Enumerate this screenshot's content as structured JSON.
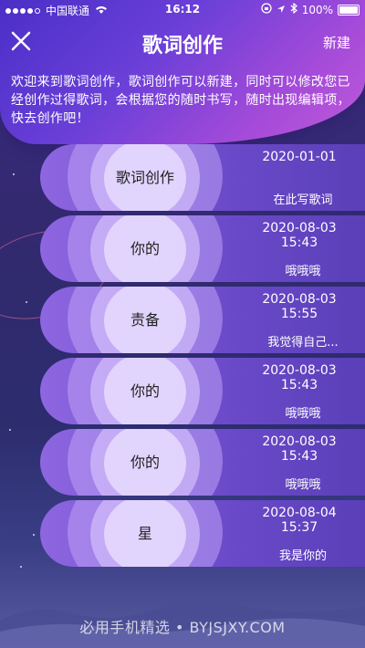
{
  "status_bar": {
    "carrier": "中国联通",
    "time": "16:12",
    "battery": "100%"
  },
  "nav": {
    "title": "歌词创作",
    "new_label": "新建"
  },
  "intro": "欢迎来到歌词创作，歌词创作可以新建，同时可以修改您已经创作过得歌词，会根据您的随时书写，随时出现编辑项，快去创作吧！",
  "cards": [
    {
      "title": "歌词创作",
      "date": "2020-01-01",
      "time": "",
      "preview": "在此写歌词"
    },
    {
      "title": "你的",
      "date": "2020-08-03",
      "time": "15:43",
      "preview": "哦哦哦"
    },
    {
      "title": "责备",
      "date": "2020-08-03",
      "time": "15:55",
      "preview": "我觉得自己..."
    },
    {
      "title": "你的",
      "date": "2020-08-03",
      "time": "15:43",
      "preview": "哦哦哦"
    },
    {
      "title": "你的",
      "date": "2020-08-03",
      "time": "15:43",
      "preview": "哦哦哦"
    },
    {
      "title": "星",
      "date": "2020-08-04",
      "time": "15:37",
      "preview": "我是你的"
    }
  ],
  "watermark": "必用手机精选 • BYJSJXY.COM",
  "colors": {
    "accent": "#6a3fd8",
    "card": "#7b57d6",
    "background": "#32296f"
  }
}
